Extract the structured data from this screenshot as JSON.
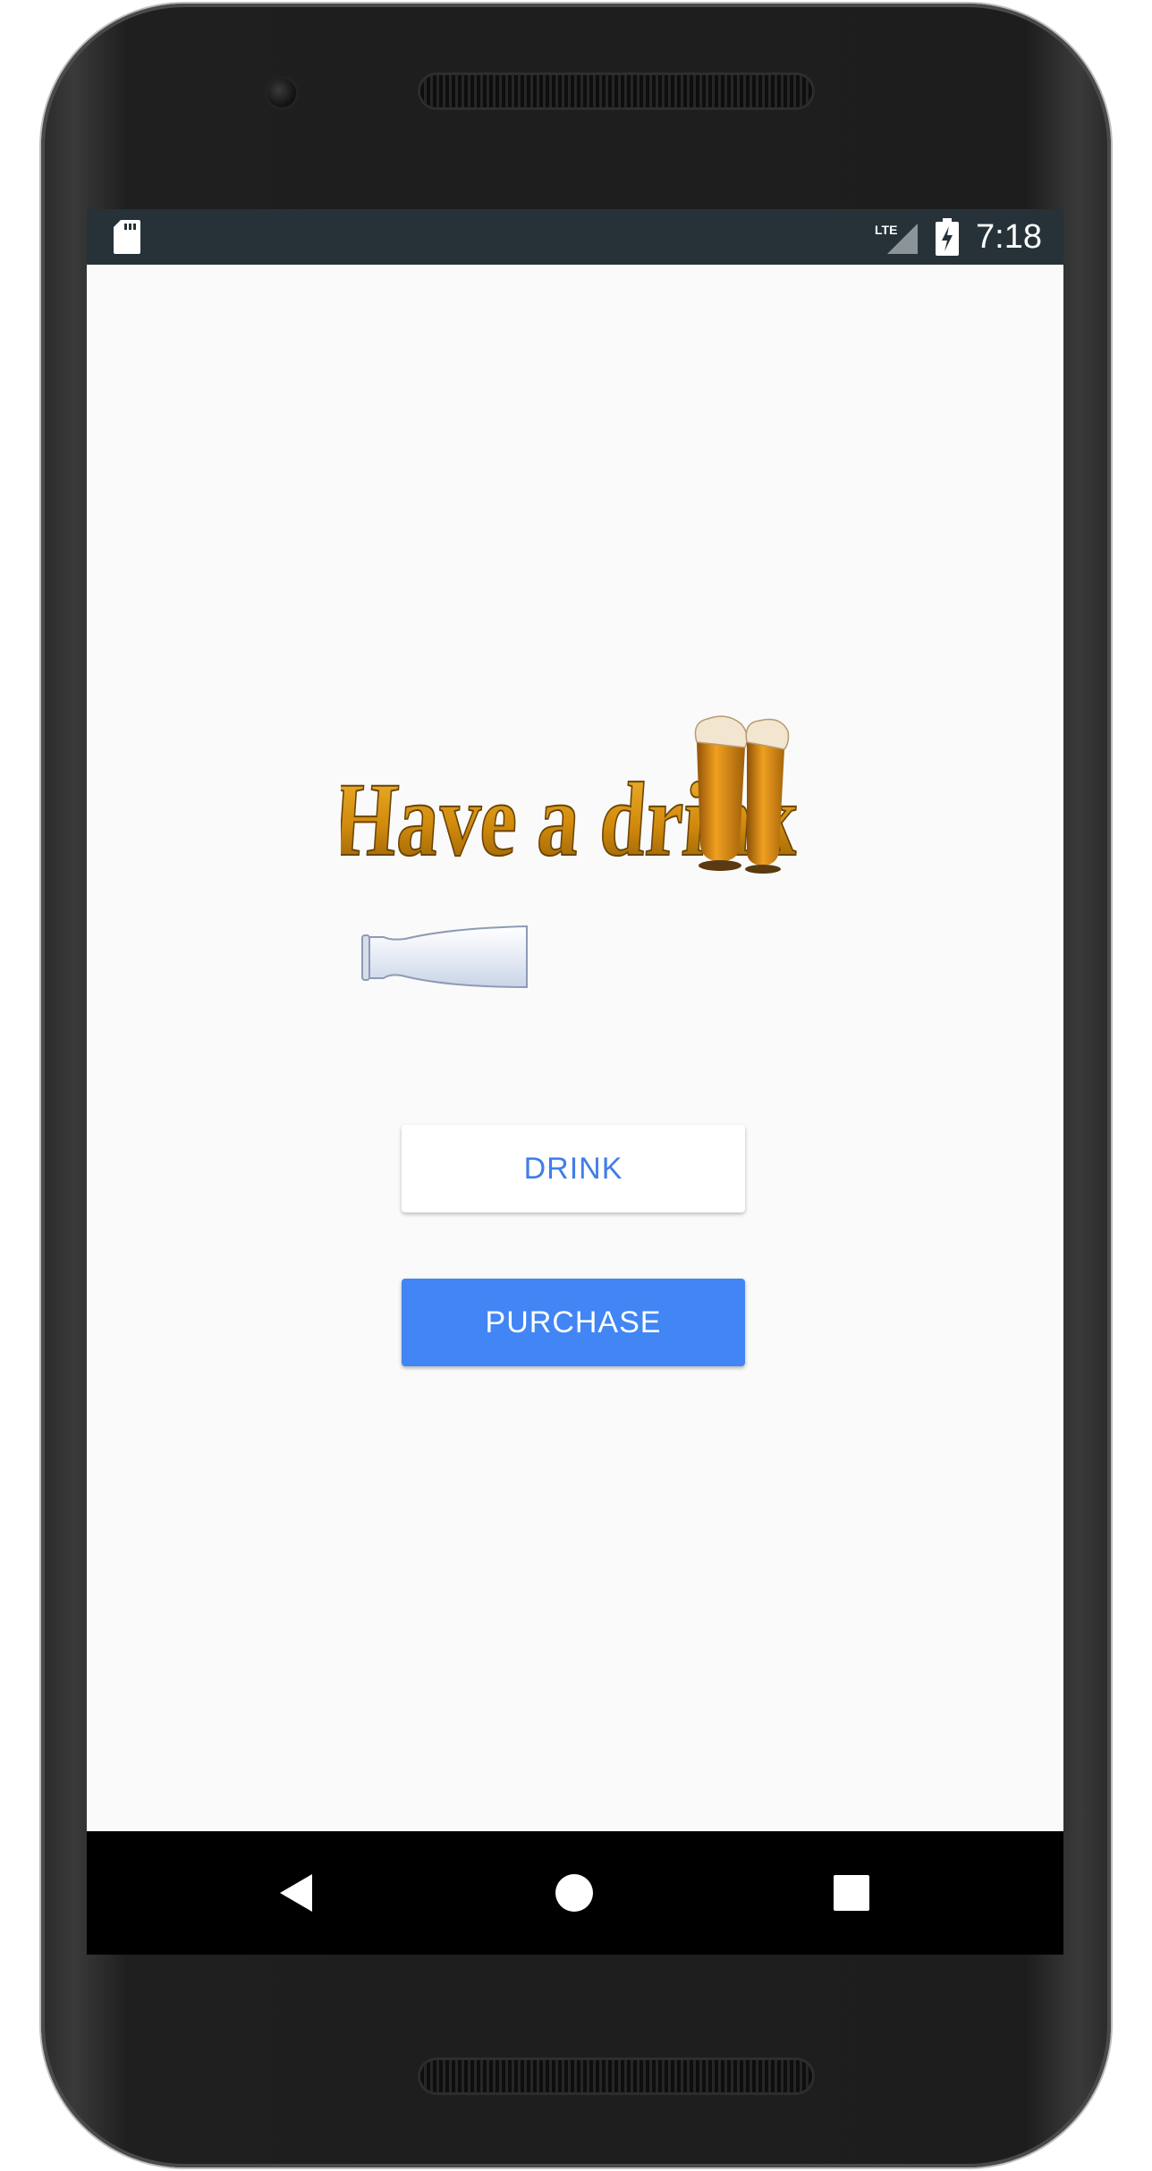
{
  "status_bar": {
    "network": "LTE",
    "time": "7:18"
  },
  "app": {
    "logo_text": "Have a drink",
    "buttons": {
      "drink": "DRINK",
      "purchase": "PURCHASE"
    }
  },
  "navigation": {
    "items": [
      "back",
      "home",
      "recents"
    ]
  },
  "colors": {
    "status_bar_bg": "#263238",
    "screen_bg": "#fafafa",
    "primary_blue": "#4285f4",
    "logo_gold": "#d18a0c"
  },
  "icons": [
    "sd-card-icon",
    "lte-signal-icon",
    "battery-charging-icon",
    "beer-glasses-icon",
    "empty-bottle-icon",
    "back-triangle-icon",
    "home-circle-icon",
    "recents-square-icon"
  ]
}
